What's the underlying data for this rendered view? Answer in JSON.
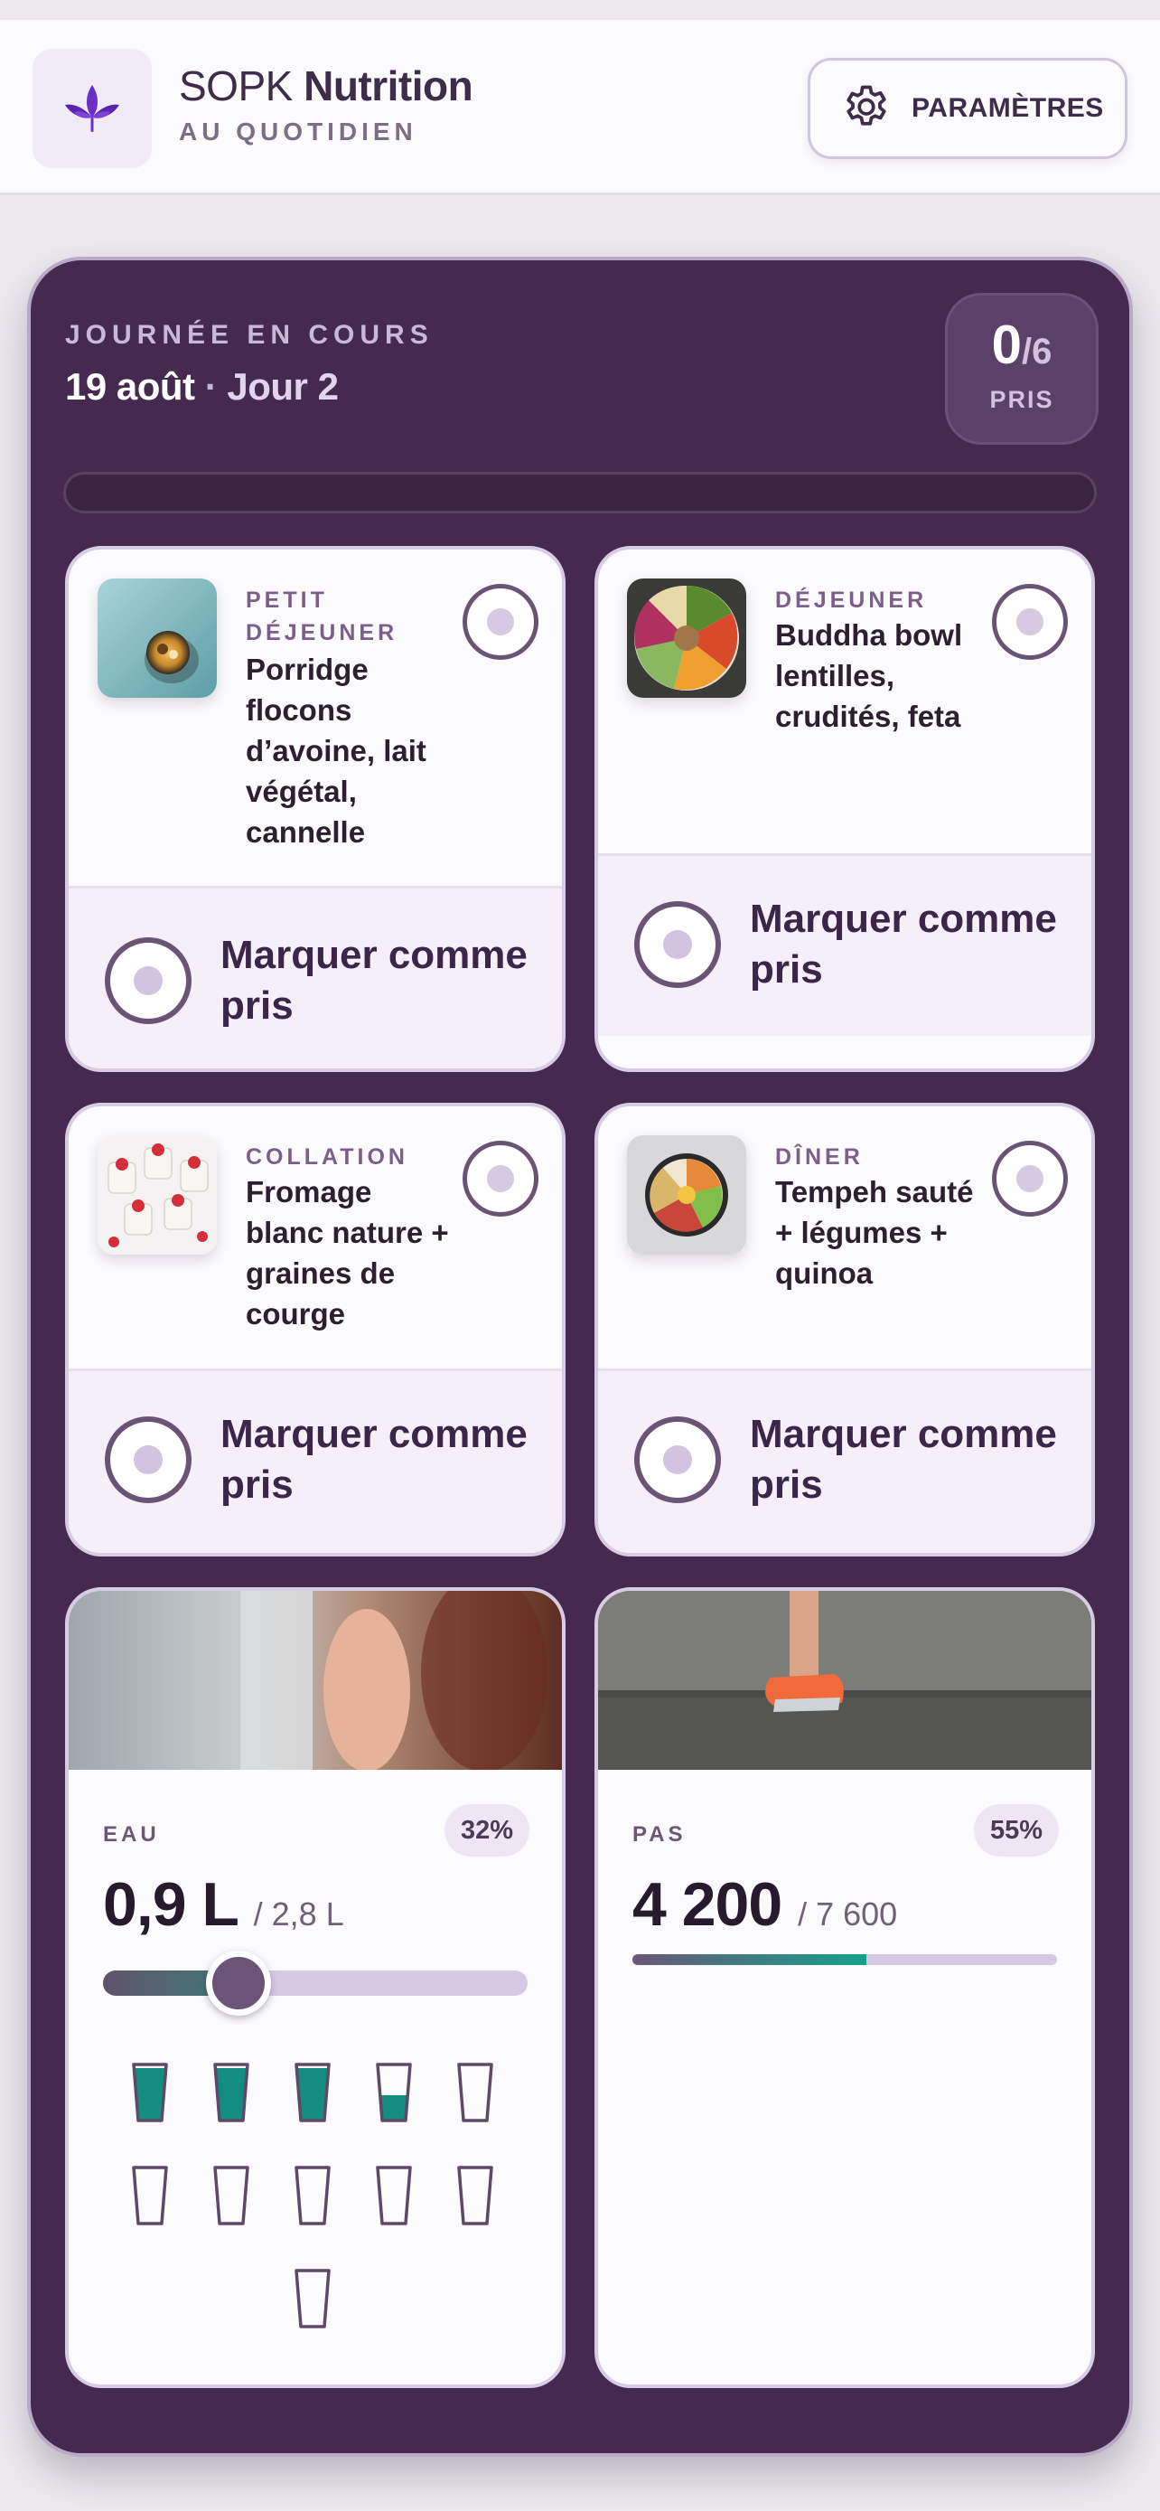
{
  "header": {
    "app_name_light": "SOPK",
    "app_name_bold": "Nutrition",
    "app_subtitle": "AU QUOTIDIEN",
    "settings_label": "PARAMÈTRES"
  },
  "day": {
    "kicker": "JOURNÉE EN COURS",
    "date": "19 août",
    "separator": "·",
    "day_label": "Jour 2",
    "taken": "0",
    "total": "/6",
    "taken_label": "PRIS",
    "progress": 0
  },
  "meals": [
    {
      "category": "PETIT DÉJEUNER",
      "title": "Porridge flocons d’avoine, lait végétal, cannelle",
      "action": "Marquer comme pris",
      "icon": "porridge-photo"
    },
    {
      "category": "DÉJEUNER",
      "title": "Buddha bowl lentilles, crudités, feta",
      "action": "Marquer comme pris",
      "icon": "buddha-bowl-photo"
    },
    {
      "category": "COLLATION",
      "title": "Fromage blanc nature + graines de courge",
      "action": "Marquer comme pris",
      "icon": "fromage-blanc-photo"
    },
    {
      "category": "DÎNER",
      "title": "Tempeh sauté + légumes + quinoa",
      "action": "Marquer comme pris",
      "icon": "tempeh-bowl-photo"
    }
  ],
  "water": {
    "kicker": "EAU",
    "percent": "32%",
    "value": "0,9 L",
    "goal": "/ 2,8 L",
    "slider_fraction": 0.32,
    "glasses_total": 11,
    "glasses_filled": 3.5
  },
  "steps": {
    "kicker": "PAS",
    "percent": "55%",
    "value": "4 200",
    "goal": "/ 7 600",
    "fraction": 0.55
  },
  "colors": {
    "panel": "#45294f",
    "accent": "#6a5475",
    "water": "#128d7f",
    "logo": "#6a2fc4"
  }
}
